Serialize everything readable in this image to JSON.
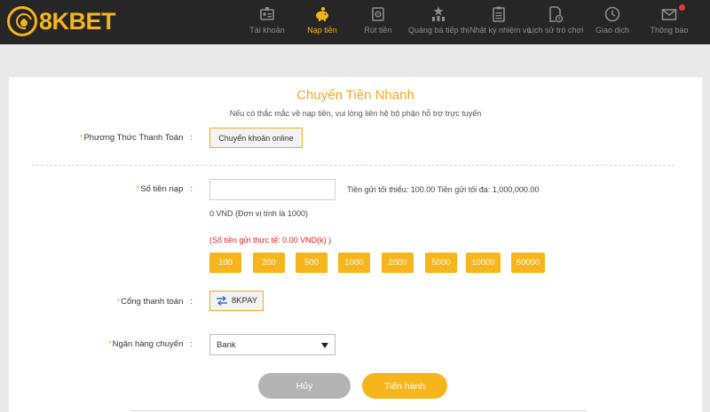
{
  "brand": {
    "logo_text": "8KBET",
    "accent": "#f6b51a"
  },
  "nav": {
    "items": [
      {
        "label": "Tài khoản",
        "icon": "id-card-icon",
        "active": false
      },
      {
        "label": "Nạp tiền",
        "icon": "piggy-bank-icon",
        "active": true
      },
      {
        "label": "Rút tiền",
        "icon": "safe-icon",
        "active": false
      },
      {
        "label": "Quảng bá tiếp thị",
        "icon": "stars-icon",
        "active": false
      },
      {
        "label": "Nhật ký nhiệm vụ",
        "icon": "clipboard-icon",
        "active": false
      },
      {
        "label": "Lịch sử trò chơi",
        "icon": "document-clock-icon",
        "active": false
      },
      {
        "label": "Giao dịch",
        "icon": "clock-icon",
        "active": false
      },
      {
        "label": "Thông báo",
        "icon": "envelope-icon",
        "active": false
      }
    ]
  },
  "form": {
    "title": "Chuyển Tiền Nhanh",
    "subtitle": "Nếu có thắc mắc về nạp tiền, vui lòng liên hệ bộ phận hỗ trợ trực tuyến",
    "method": {
      "label": "Phương Thức Thanh Toán",
      "colon": ":",
      "value": "Chuyển khoản online"
    },
    "amount": {
      "label": "Số tiền nạp",
      "colon": ":",
      "value": "",
      "limits": "Tiền gửi tối thiểu: 100.00 Tiền gửi tối đa: 1,000,000.00",
      "unit_note": "0 VND (Đơn vị tính là 1000)",
      "real_note": "(Số tiền gửi thực tế: 0.00 VND(k) )",
      "quick_values": [
        "100",
        "200",
        "500",
        "1000",
        "2000",
        "5000",
        "10000",
        "50000"
      ]
    },
    "gateway": {
      "label": "Cổng thanh toán",
      "colon": ":",
      "value": "8KPAY"
    },
    "bank": {
      "label": "Ngân hàng chuyển",
      "colon": ":",
      "selected": "Bank"
    },
    "cancel_label": "Hủy",
    "submit_label": "Tiến hành"
  },
  "required_mark": "*"
}
